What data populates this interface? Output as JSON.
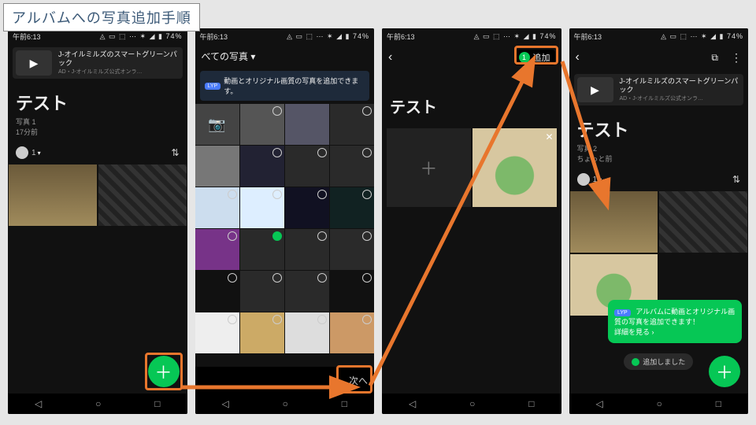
{
  "caption": "アルバムへの写真追加手順",
  "status": {
    "time": "午前6:13",
    "battery": "74%",
    "icons": "◬ ▭ ⬚ ⋯ ✶ ◢ ▮"
  },
  "nav": {
    "back": "◁",
    "home": "○",
    "recent": "□"
  },
  "ad": {
    "title": "J-オイルミルズのスマートグリーンパック",
    "sub": "AD・J-オイルミルズ公式オンラ…"
  },
  "album": {
    "title": "テスト",
    "sub1": "写真 1",
    "sub1_time": "17分前",
    "sub2": "写真 2",
    "sub2_time": "ちょっと前",
    "user_count": "1",
    "sort_icon": "⇅"
  },
  "picker": {
    "tab": "べての写真 ▾",
    "note": "動画とオリジナル画質の写真を追加できます。",
    "lyp": "LYP",
    "next": "次へ"
  },
  "p3": {
    "add_label": "追加",
    "badge": "1"
  },
  "toast": {
    "text": "アルバムに動画とオリジナル画質の写真を追加できます！",
    "link": "詳細を見る ›"
  },
  "snack": "追加しました",
  "icons": {
    "plus": "＋",
    "camera": "📷",
    "play": "▶",
    "close": "✕",
    "back": "‹",
    "menu": "⋮",
    "cast": "⧉",
    "chevron": "▾"
  }
}
